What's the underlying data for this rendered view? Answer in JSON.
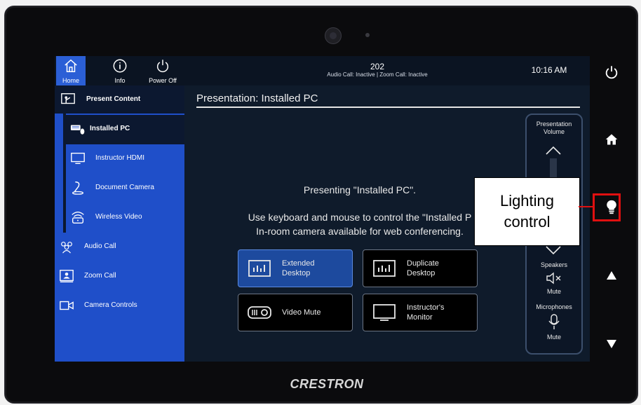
{
  "device": {
    "brand": "CRESTRON"
  },
  "nav": [
    {
      "label": "Home",
      "icon": "home-icon"
    },
    {
      "label": "Info",
      "icon": "info-icon"
    },
    {
      "label": "Power Off",
      "icon": "power-icon"
    }
  ],
  "room": {
    "number": "202",
    "status": "Audio Call: Inactive | Zoom Call: Inactive"
  },
  "clock": "10:16 AM",
  "sidebar": {
    "present_content": "Present Content",
    "sources": [
      "Installed PC",
      "Instructor HDMI",
      "Document Camera",
      "Wireless Video"
    ],
    "items": [
      "Audio Call",
      "Zoom Call",
      "Camera Controls"
    ]
  },
  "content": {
    "title": "Presentation: Installed PC",
    "message_line1": "Presenting \"Installed PC\".",
    "message_line2": "Use keyboard and mouse to control the \"Installed P",
    "message_line3": "In-room camera available for web conferencing.",
    "buttons": [
      {
        "line1": "Extended",
        "line2": "Desktop",
        "active": true
      },
      {
        "line1": "Duplicate",
        "line2": "Desktop",
        "active": false
      },
      {
        "line1": "Video Mute",
        "line2": "",
        "active": false
      },
      {
        "line1": "Instructor's",
        "line2": "Monitor",
        "active": false
      }
    ]
  },
  "volume_panel": {
    "title_line1": "Presentation",
    "title_line2": "Volume",
    "level": 0.25,
    "speakers_label": "Speakers",
    "speakers_mute": "Mute",
    "microphones_label": "Microphones",
    "microphones_mute": "Mute"
  },
  "hardware_buttons": [
    "power-icon",
    "home-icon",
    "light-bulb-icon",
    "triangle-up-icon",
    "triangle-down-icon"
  ],
  "annotation": {
    "line1": "Lighting",
    "line2": "control",
    "color": "#e01010"
  }
}
